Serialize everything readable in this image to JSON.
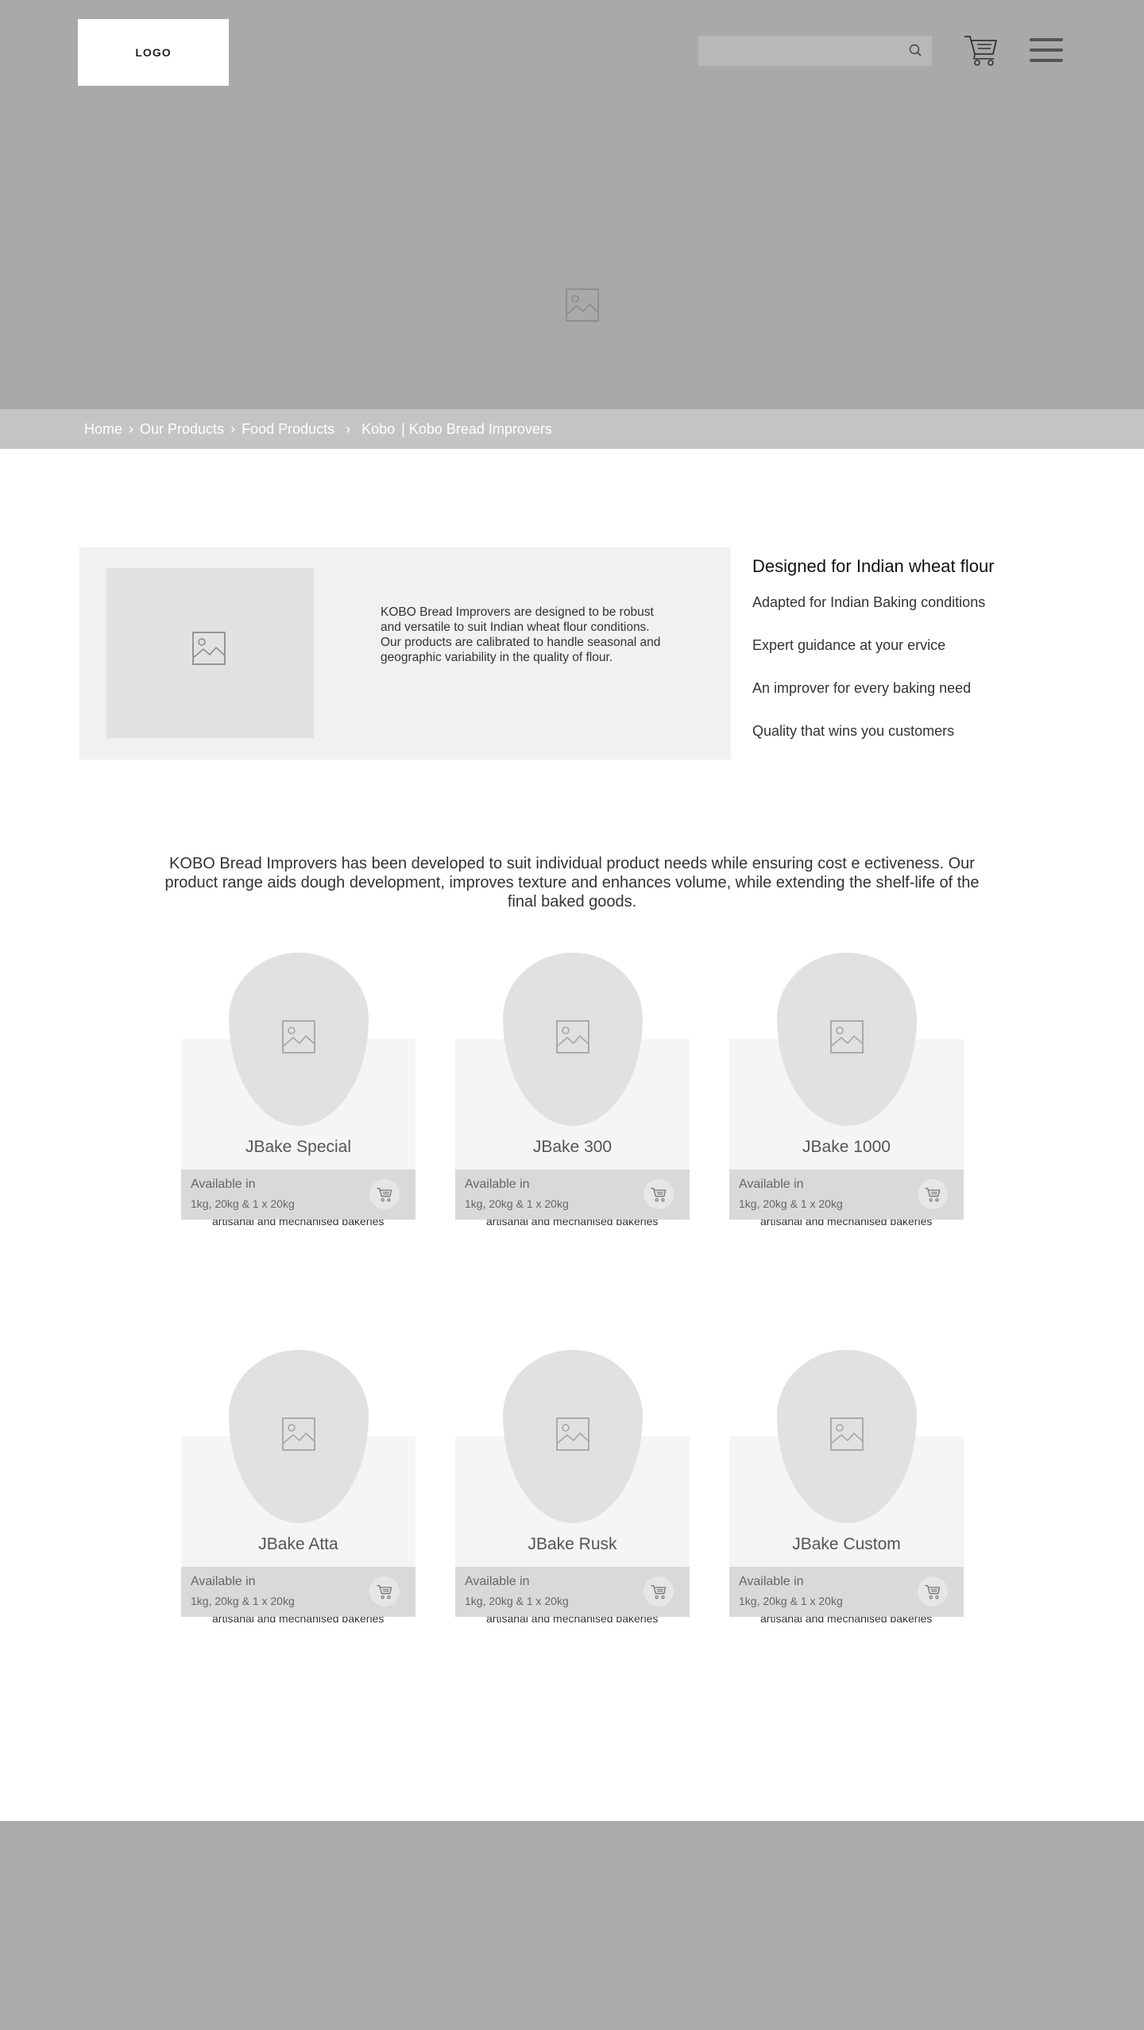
{
  "header": {
    "logo": "LOGO",
    "search_placeholder": ""
  },
  "breadcrumb": {
    "items": [
      "Home",
      "Our Products",
      "Food Products",
      "Kobo"
    ],
    "current": "| Kobo Bread Improvers"
  },
  "intro": {
    "text": "KOBO Bread Improvers are designed to be robust and versatile to suit Indian wheat flour conditions. Our products are calibrated to handle seasonal and geographic variability in the quality of flour.",
    "feature_title": "Designed for Indian wheat flour",
    "features": [
      "Adapted for Indian Baking conditions",
      "Expert guidance at your ervice",
      "An improver for every baking need",
      "Quality that wins you customers"
    ]
  },
  "description": "KOBO Bread Improvers has been developed to suit individual product needs while ensuring cost e ectiveness. Our product range aids dough development, improves texture and enhances volume, while extending the shelf-life of the final baked goods.",
  "products": [
    {
      "name": "JBake Special",
      "text": "Conventional improver Aids in dough development and improves volume and texture Suited for artisanal and mechanised bakeries",
      "available_label": "Available in",
      "available": "1kg, 20kg & 1 x 20kg"
    },
    {
      "name": "JBake 300",
      "text": "Conventional improver Aids in dough development and improves volume and texture Suited for artisanal and mechanised bakeries",
      "available_label": "Available in",
      "available": "1kg, 20kg & 1 x 20kg"
    },
    {
      "name": "JBake 1000",
      "text": "Conventional improver Aids in dough development and improves volume and texture Suited for artisanal and mechanised bakeries",
      "available_label": "Available in",
      "available": "1kg, 20kg & 1 x 20kg"
    },
    {
      "name": "JBake Atta",
      "text": "Conventional improver Aids in dough development and improves volume and texture Suited for artisanal and mechanised bakeries",
      "available_label": "Available in",
      "available": "1kg, 20kg & 1 x 20kg"
    },
    {
      "name": "JBake Rusk",
      "text": "Conventional improver Aids in dough development and improves volume and texture Suited for artisanal and mechanised bakeries",
      "available_label": "Available in",
      "available": "1kg, 20kg & 1 x 20kg"
    },
    {
      "name": "JBake Custom",
      "text": "Conventional improver Aids in dough development and improves volume and texture Suited for artisanal and mechanised bakeries",
      "available_label": "Available in",
      "available": "1kg, 20kg & 1 x 20kg"
    }
  ],
  "icons": {
    "search": "search-icon",
    "cart": "cart-icon",
    "menu": "hamburger-menu-icon",
    "image": "image-placeholder-icon"
  }
}
